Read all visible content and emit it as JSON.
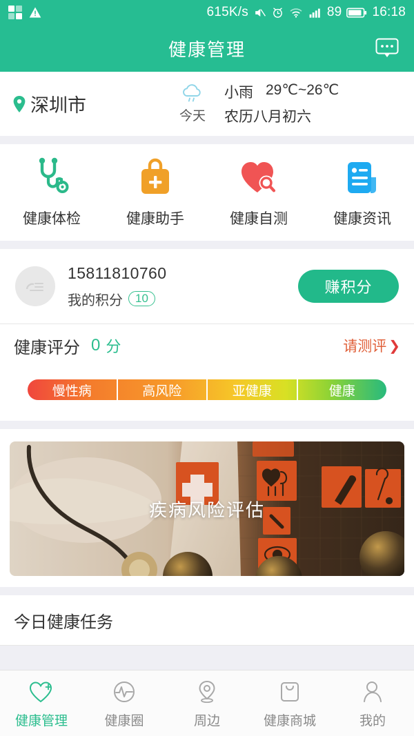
{
  "status_bar": {
    "left_icons": [
      "app-grid-icon",
      "warning-triangle-icon"
    ],
    "net_speed": "615K/s",
    "icons": [
      "mute-icon",
      "alarm-icon",
      "wifi-icon",
      "signal-icon"
    ],
    "battery_level": "89",
    "time": "16:18"
  },
  "header": {
    "title": "健康管理",
    "message_icon": "chat-bubble-icon"
  },
  "weather": {
    "location_icon": "location-pin-icon",
    "city": "深圳市",
    "weather_icon": "cloud-rain-icon",
    "day_label": "今天",
    "condition": "小雨",
    "temperature": "29℃~26℃",
    "lunar_date": "农历八月初六"
  },
  "features": [
    {
      "icon": "stethoscope-icon",
      "label": "健康体检",
      "color": "#2bb98a"
    },
    {
      "icon": "medical-bag-icon",
      "label": "健康助手",
      "color": "#f0a028"
    },
    {
      "icon": "heart-search-icon",
      "label": "健康自测",
      "color": "#f05454"
    },
    {
      "icon": "document-icon",
      "label": "健康资讯",
      "color": "#1eaaf1"
    }
  ],
  "user": {
    "avatar_icon": "avatar-placeholder-icon",
    "phone": "15811810760",
    "points_label": "我的积分",
    "points_value": "10",
    "earn_button": "赚积分"
  },
  "score": {
    "label": "健康评分",
    "value": "0",
    "unit": "分",
    "link_text": "请测评",
    "chevron_icon": "chevron-right-icon",
    "levels": [
      {
        "label": "慢性病",
        "color": "#f0473d"
      },
      {
        "label": "高风险",
        "color": "#f47b2c"
      },
      {
        "label": "亚健康",
        "color": "#f6c728"
      },
      {
        "label": "健康",
        "color": "#28ba7d"
      }
    ]
  },
  "banner": {
    "caption": "疾病风险评估"
  },
  "tasks": {
    "title": "今日健康任务"
  },
  "tabs": [
    {
      "icon": "heart-plus-icon",
      "label": "健康管理",
      "active": true
    },
    {
      "icon": "pulse-circle-icon",
      "label": "健康圈",
      "active": false
    },
    {
      "icon": "location-pin-icon",
      "label": "周边",
      "active": false
    },
    {
      "icon": "shopping-bag-icon",
      "label": "健康商城",
      "active": false
    },
    {
      "icon": "person-icon",
      "label": "我的",
      "active": false
    }
  ],
  "theme": {
    "primary": "#26bd92",
    "accent_orange": "#e0603a",
    "bg": "#efeff4"
  }
}
